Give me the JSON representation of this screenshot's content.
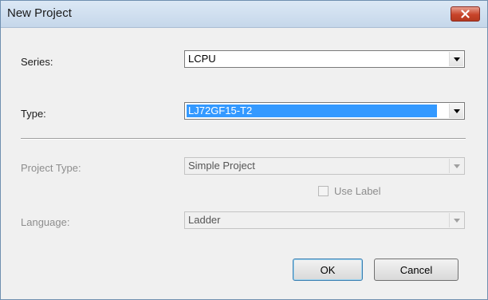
{
  "window": {
    "title": "New Project",
    "close_icon": "close-icon"
  },
  "form": {
    "series": {
      "label": "Series:",
      "value": "LCPU"
    },
    "type": {
      "label": "Type:",
      "value": "LJ72GF15-T2"
    },
    "project_type": {
      "label": "Project Type:",
      "value": "Simple Project",
      "enabled": false
    },
    "use_label": {
      "label": "Use Label",
      "checked": false,
      "enabled": false
    },
    "language": {
      "label": "Language:",
      "value": "Ladder",
      "enabled": false
    }
  },
  "buttons": {
    "ok": "OK",
    "cancel": "Cancel"
  },
  "colors": {
    "selection": "#3399ff",
    "close_button": "#c8442a"
  }
}
